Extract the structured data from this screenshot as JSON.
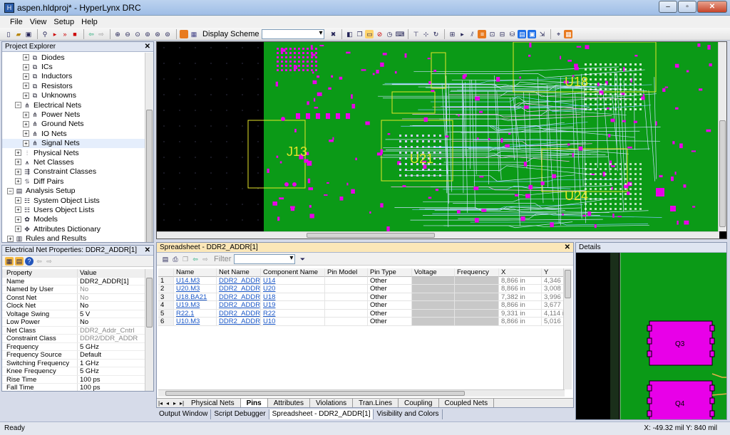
{
  "window": {
    "title": "aspen.hldproj* - HyperLynx DRC"
  },
  "menu": [
    "File",
    "View",
    "Setup",
    "Help"
  ],
  "toolbar": {
    "display_scheme_label": "Display Scheme",
    "display_scheme_value": ""
  },
  "project_explorer": {
    "title": "Project Explorer",
    "items": [
      {
        "label": "Diodes",
        "depth": 3,
        "exp": "+",
        "icon": "components-icon"
      },
      {
        "label": "ICs",
        "depth": 3,
        "exp": "+",
        "icon": "components-icon"
      },
      {
        "label": "Inductors",
        "depth": 3,
        "exp": "+",
        "icon": "components-icon"
      },
      {
        "label": "Resistors",
        "depth": 3,
        "exp": "+",
        "icon": "components-icon"
      },
      {
        "label": "Unknowns",
        "depth": 3,
        "exp": "+",
        "icon": "components-icon"
      },
      {
        "label": "Electrical Nets",
        "depth": 2,
        "exp": "−",
        "icon": "nets-icon"
      },
      {
        "label": "Power Nets",
        "depth": 3,
        "exp": "+",
        "icon": "nets-icon"
      },
      {
        "label": "Ground Nets",
        "depth": 3,
        "exp": "+",
        "icon": "nets-icon"
      },
      {
        "label": "IO Nets",
        "depth": 3,
        "exp": "+",
        "icon": "nets-icon"
      },
      {
        "label": "Signal Nets",
        "depth": 3,
        "exp": "+",
        "icon": "nets-icon",
        "selected": true
      },
      {
        "label": "Physical Nets",
        "depth": 2,
        "exp": "+",
        "icon": "physical-nets-icon"
      },
      {
        "label": "Net Classes",
        "depth": 2,
        "exp": "+",
        "icon": "net-classes-icon"
      },
      {
        "label": "Constraint Classes",
        "depth": 2,
        "exp": "+",
        "icon": "constraint-icon"
      },
      {
        "label": "Diff Pairs",
        "depth": 2,
        "exp": "+",
        "icon": "diff-pairs-icon"
      },
      {
        "label": "Analysis Setup",
        "depth": 1,
        "exp": "−",
        "icon": "analysis-icon"
      },
      {
        "label": "System Object Lists",
        "depth": 2,
        "exp": "+",
        "icon": "list-icon"
      },
      {
        "label": "Users Object Lists",
        "depth": 2,
        "exp": "+",
        "icon": "list-icon"
      },
      {
        "label": "Models",
        "depth": 2,
        "exp": "+",
        "icon": "models-icon"
      },
      {
        "label": "Attributes Dictionary",
        "depth": 2,
        "exp": "+",
        "icon": "attributes-icon"
      },
      {
        "label": "Rules and Results",
        "depth": 1,
        "exp": "+",
        "icon": "rules-icon"
      }
    ]
  },
  "net_properties": {
    "title": "Electrical Net Properties: DDR2_ADDR[1]",
    "columns": [
      "Property",
      "Value"
    ],
    "rows": [
      {
        "k": "Name",
        "v": "DDR2_ADDR[1]",
        "gray": false
      },
      {
        "k": "Named by User",
        "v": "No",
        "gray": true
      },
      {
        "k": "Const Net",
        "v": "No",
        "gray": true
      },
      {
        "k": "Clock Net",
        "v": "No",
        "gray": false
      },
      {
        "k": "Voltage Swing",
        "v": "5 V",
        "gray": false
      },
      {
        "k": "Low Power",
        "v": "No",
        "gray": false
      },
      {
        "k": "Net Class",
        "v": "DDR2_Addr_Cntrl",
        "gray": true
      },
      {
        "k": "Constraint Class",
        "v": "DDR2/DDR_ADDR",
        "gray": true
      },
      {
        "k": "Frequency",
        "v": "5 GHz",
        "gray": false
      },
      {
        "k": "Frequency Source",
        "v": "Default",
        "gray": false
      },
      {
        "k": "Switching Frequency",
        "v": "1 GHz",
        "gray": false
      },
      {
        "k": "Knee Frequency",
        "v": "5 GHz",
        "gray": false
      },
      {
        "k": "Rise Time",
        "v": "100 ps",
        "gray": false
      },
      {
        "k": "Fall Time",
        "v": "100 ps",
        "gray": false
      }
    ]
  },
  "pcb": {
    "labels": [
      "J13",
      "U21",
      "U18",
      "U24"
    ],
    "colors": {
      "board": "#0b9a17",
      "pad": "#e800e8",
      "trace": "#c8e0ff",
      "outline": "#e5e52a",
      "background": "#000000"
    }
  },
  "spreadsheet": {
    "title": "Spreadsheet - DDR2_ADDR[1]",
    "filter_placeholder": "Filter",
    "columns": [
      "",
      "Name",
      "Net Name",
      "Component Name",
      "Pin Model",
      "Pin Type",
      "Voltage",
      "Frequency",
      "X",
      "Y"
    ],
    "rows": [
      {
        "n": "1",
        "name": "U14.M3",
        "net": "DDR2_ADDR[",
        "comp": "U14",
        "model": "",
        "type": "Other",
        "voltage": "",
        "freq": "",
        "x": "8,866 in",
        "y": "4,346 in"
      },
      {
        "n": "2",
        "name": "U20.M3",
        "net": "DDR2_ADDR[",
        "comp": "U20",
        "model": "",
        "type": "Other",
        "voltage": "",
        "freq": "",
        "x": "8,866 in",
        "y": "3,008 in"
      },
      {
        "n": "3",
        "name": "U18.BA21",
        "net": "DDR2_ADDR[",
        "comp": "U18",
        "model": "",
        "type": "Other",
        "voltage": "",
        "freq": "",
        "x": "7,382 in",
        "y": "3,996 in"
      },
      {
        "n": "4",
        "name": "U19.M3",
        "net": "DDR2_ADDR[",
        "comp": "U19",
        "model": "",
        "type": "Other",
        "voltage": "",
        "freq": "",
        "x": "8,866 in",
        "y": "3,677 in"
      },
      {
        "n": "5",
        "name": "R22.1",
        "net": "DDR2_ADDR[",
        "comp": "R22",
        "model": "",
        "type": "Other",
        "voltage": "",
        "freq": "",
        "x": "9,331 in",
        "y": "4,114 in"
      },
      {
        "n": "6",
        "name": "U10.M3",
        "net": "DDR2_ADDR[",
        "comp": "U10",
        "model": "",
        "type": "Other",
        "voltage": "",
        "freq": "",
        "x": "8,866 in",
        "y": "5,016 in"
      }
    ],
    "sheet_tabs": [
      "Physical Nets",
      "Pins",
      "Attributes",
      "Violations",
      "Tran.Lines",
      "Coupling",
      "Coupled Nets"
    ],
    "active_sheet_tab": "Pins"
  },
  "bottom_tabs": [
    "Output Window",
    "Script Debugger",
    "Spreadsheet - DDR2_ADDR[1]",
    "Visibility and Colors"
  ],
  "active_bottom_tab": "Spreadsheet - DDR2_ADDR[1]",
  "details": {
    "title": "Details",
    "labels": [
      "Q3",
      "Q4"
    ]
  },
  "status": {
    "text": "Ready",
    "coords": "X: -49.32 mil  Y: 840 mil"
  }
}
